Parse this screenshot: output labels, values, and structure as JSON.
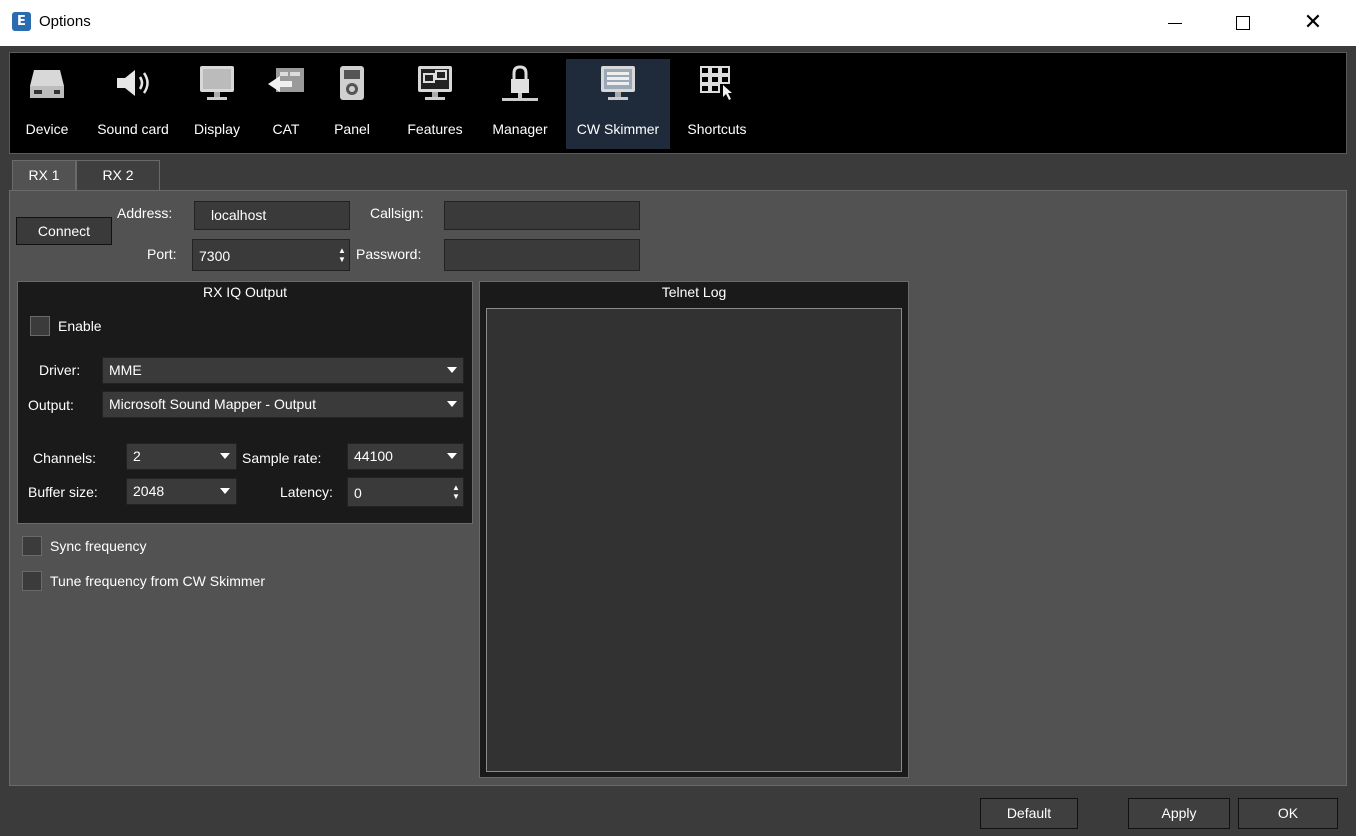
{
  "window": {
    "title": "Options",
    "app_icon_glyph": "E",
    "minimize_icon": "minimize-icon",
    "maximize_icon": "maximize-icon",
    "close_icon": "close-icon"
  },
  "toolbar": {
    "items": [
      {
        "label": "Device",
        "icon": "device-icon",
        "active": false
      },
      {
        "label": "Sound card",
        "icon": "speaker-icon",
        "active": false
      },
      {
        "label": "Display",
        "icon": "monitor-icon",
        "active": false
      },
      {
        "label": "CAT",
        "icon": "cat-icon",
        "active": false
      },
      {
        "label": "Panel",
        "icon": "panel-icon",
        "active": false
      },
      {
        "label": "Features",
        "icon": "features-icon",
        "active": false
      },
      {
        "label": "Manager",
        "icon": "lock-icon",
        "active": false
      },
      {
        "label": "CW Skimmer",
        "icon": "cw-skimmer-icon",
        "active": true
      },
      {
        "label": "Shortcuts",
        "icon": "keyboard-icon",
        "active": false
      }
    ]
  },
  "tabs": [
    {
      "label": "RX 1",
      "active": true
    },
    {
      "label": "RX 2",
      "active": false
    }
  ],
  "connection": {
    "connect_label": "Connect",
    "address_label": "Address:",
    "address_value": "localhost",
    "port_label": "Port:",
    "port_value": "7300",
    "callsign_label": "Callsign:",
    "callsign_value": "",
    "password_label": "Password:",
    "password_value": ""
  },
  "rx_iq_output": {
    "title": "RX IQ Output",
    "enable_label": "Enable",
    "enable_checked": false,
    "driver_label": "Driver:",
    "driver_value": "MME",
    "output_label": "Output:",
    "output_value": "Microsoft Sound Mapper - Output",
    "channels_label": "Channels:",
    "channels_value": "2",
    "sample_rate_label": "Sample rate:",
    "sample_rate_value": "44100",
    "buffer_size_label": "Buffer size:",
    "buffer_size_value": "2048",
    "latency_label": "Latency:",
    "latency_value": "0"
  },
  "options": {
    "sync_frequency_label": "Sync frequency",
    "sync_frequency_checked": false,
    "tune_frequency_label": "Tune frequency from CW Skimmer",
    "tune_frequency_checked": false
  },
  "telnet_log": {
    "title": "Telnet Log",
    "content": ""
  },
  "footer": {
    "default_label": "Default",
    "apply_label": "Apply",
    "ok_label": "OK"
  },
  "colors": {
    "frame_bg": "#3b3b3b",
    "panel_bg": "#525252",
    "group_bg": "#1a1a1a",
    "toolbar_bg": "#000000",
    "active_tool_bg": "#1f2a3a"
  }
}
